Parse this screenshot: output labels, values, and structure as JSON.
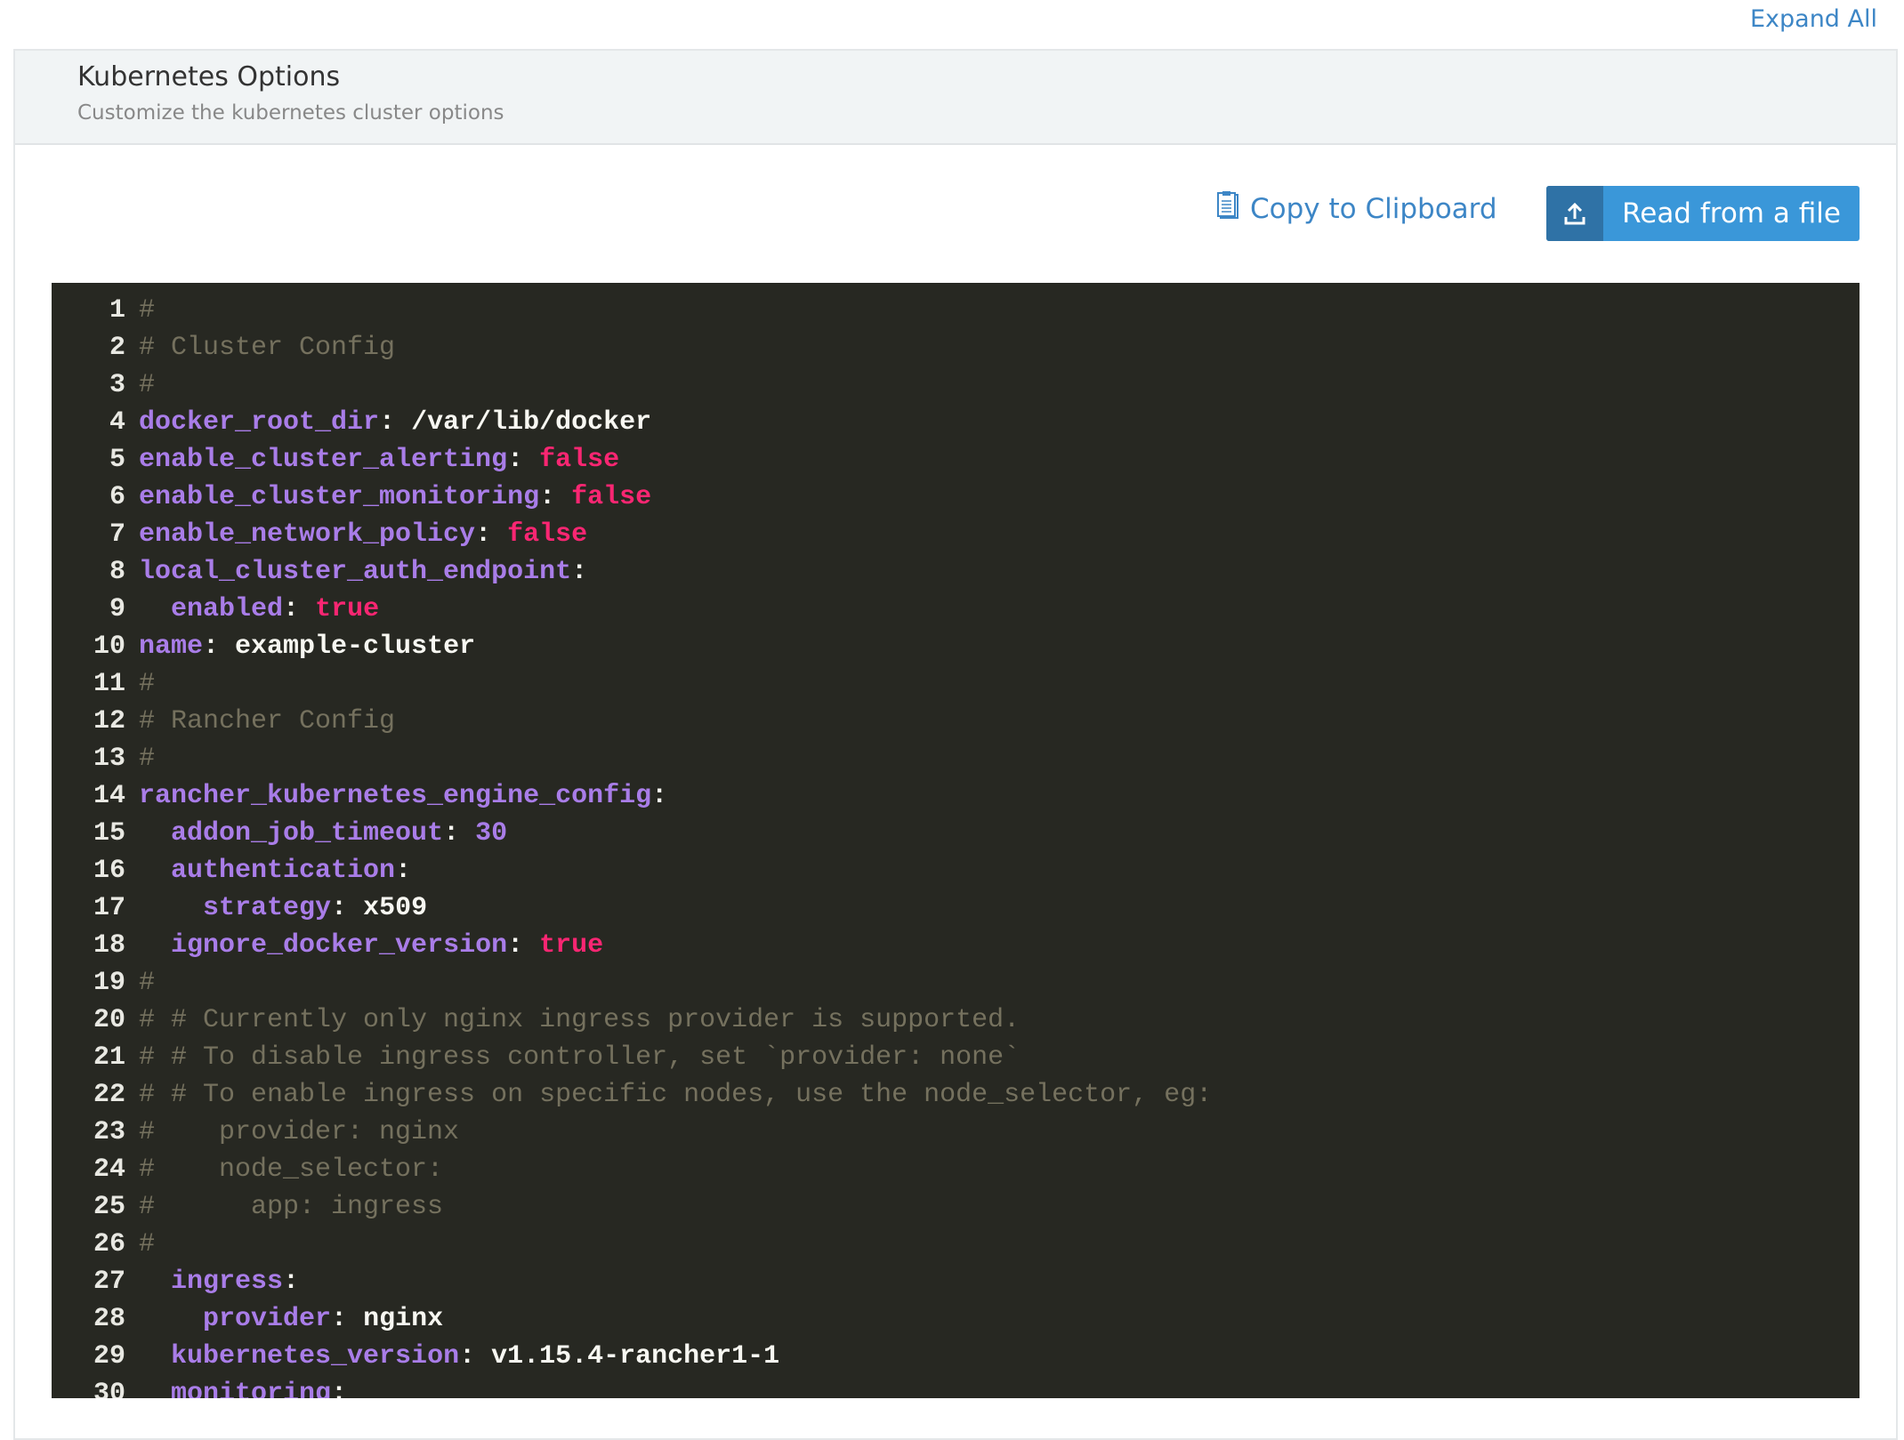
{
  "top": {
    "expand_all": "Expand All"
  },
  "panel": {
    "title": "Kubernetes Options",
    "subtitle": "Customize the kubernetes cluster options"
  },
  "toolbar": {
    "copy_label": "Copy to Clipboard",
    "copy_icon": "clipboard-icon",
    "read_label": "Read from a file",
    "read_icon": "upload-icon"
  },
  "colors": {
    "accent": "#3a97d9",
    "editor_bg": "#272822",
    "key": "#a97de8",
    "bool": "#f92672",
    "comment": "#75715e"
  },
  "editor": {
    "lines": [
      [
        [
          "c",
          "#"
        ]
      ],
      [
        [
          "c",
          "# Cluster Config"
        ]
      ],
      [
        [
          "c",
          "#"
        ]
      ],
      [
        [
          "k",
          "docker_root_dir"
        ],
        [
          "p",
          ": "
        ],
        [
          "v",
          "/var/lib/docker"
        ]
      ],
      [
        [
          "k",
          "enable_cluster_alerting"
        ],
        [
          "p",
          ": "
        ],
        [
          "b",
          "false"
        ]
      ],
      [
        [
          "k",
          "enable_cluster_monitoring"
        ],
        [
          "p",
          ": "
        ],
        [
          "b",
          "false"
        ]
      ],
      [
        [
          "k",
          "enable_network_policy"
        ],
        [
          "p",
          ": "
        ],
        [
          "b",
          "false"
        ]
      ],
      [
        [
          "k",
          "local_cluster_auth_endpoint"
        ],
        [
          "p",
          ":"
        ]
      ],
      [
        [
          "p",
          "  "
        ],
        [
          "k",
          "enabled"
        ],
        [
          "p",
          ": "
        ],
        [
          "b",
          "true"
        ]
      ],
      [
        [
          "k",
          "name"
        ],
        [
          "p",
          ": "
        ],
        [
          "v",
          "example-cluster"
        ]
      ],
      [
        [
          "c",
          "#"
        ]
      ],
      [
        [
          "c",
          "# Rancher Config"
        ]
      ],
      [
        [
          "c",
          "#"
        ]
      ],
      [
        [
          "k",
          "rancher_kubernetes_engine_config"
        ],
        [
          "p",
          ":"
        ]
      ],
      [
        [
          "p",
          "  "
        ],
        [
          "k",
          "addon_job_timeout"
        ],
        [
          "p",
          ": "
        ],
        [
          "n",
          "30"
        ]
      ],
      [
        [
          "p",
          "  "
        ],
        [
          "k",
          "authentication"
        ],
        [
          "p",
          ":"
        ]
      ],
      [
        [
          "p",
          "    "
        ],
        [
          "k",
          "strategy"
        ],
        [
          "p",
          ": "
        ],
        [
          "v",
          "x509"
        ]
      ],
      [
        [
          "p",
          "  "
        ],
        [
          "k",
          "ignore_docker_version"
        ],
        [
          "p",
          ": "
        ],
        [
          "b",
          "true"
        ]
      ],
      [
        [
          "c",
          "#"
        ]
      ],
      [
        [
          "c",
          "# # Currently only nginx ingress provider is supported."
        ]
      ],
      [
        [
          "c",
          "# # To disable ingress controller, set `provider: none`"
        ]
      ],
      [
        [
          "c",
          "# # To enable ingress on specific nodes, use the node_selector, eg:"
        ]
      ],
      [
        [
          "c",
          "#    provider: nginx"
        ]
      ],
      [
        [
          "c",
          "#    node_selector:"
        ]
      ],
      [
        [
          "c",
          "#      app: ingress"
        ]
      ],
      [
        [
          "c",
          "#"
        ]
      ],
      [
        [
          "p",
          "  "
        ],
        [
          "k",
          "ingress"
        ],
        [
          "p",
          ":"
        ]
      ],
      [
        [
          "p",
          "    "
        ],
        [
          "k",
          "provider"
        ],
        [
          "p",
          ": "
        ],
        [
          "v",
          "nginx"
        ]
      ],
      [
        [
          "p",
          "  "
        ],
        [
          "k",
          "kubernetes_version"
        ],
        [
          "p",
          ": "
        ],
        [
          "v",
          "v1.15.4-rancher1-1"
        ]
      ],
      [
        [
          "p",
          "  "
        ],
        [
          "k",
          "monitoring"
        ],
        [
          "p",
          ":"
        ]
      ]
    ]
  }
}
